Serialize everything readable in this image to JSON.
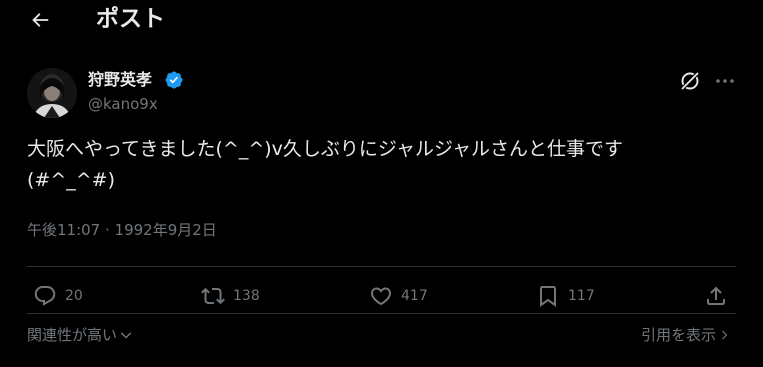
{
  "header": {
    "title": "ポスト"
  },
  "tweet": {
    "author_name": "狩野英孝",
    "handle": "@kano9x",
    "text": "大阪へやってきました(^_^)v久しぶりにジャルジャルさんと仕事です\n(#^_^#)",
    "timestamp": "午後11:07 · 1992年9月2日"
  },
  "actions": {
    "reply_count": "20",
    "retweet_count": "138",
    "like_count": "417",
    "bookmark_count": "117"
  },
  "footer": {
    "sort_label": "関連性が高い",
    "quotes_label": "引用を表示"
  },
  "colors": {
    "background": "#000000",
    "text": "#e7e9ea",
    "muted": "#71767b",
    "divider": "#2f3336",
    "verified": "#1d9bf0"
  },
  "icons": [
    "back-arrow-icon",
    "verified-badge-icon",
    "grok-icon",
    "more-icon",
    "reply-icon",
    "retweet-icon",
    "like-icon",
    "bookmark-icon",
    "share-icon",
    "chevron-down-icon",
    "chevron-right-icon"
  ]
}
